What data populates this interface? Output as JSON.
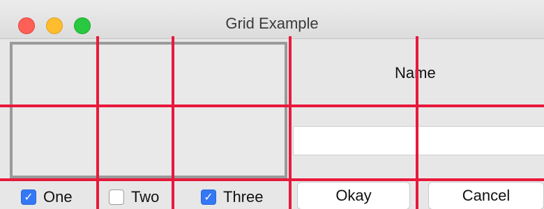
{
  "window": {
    "title": "Grid Example"
  },
  "form": {
    "name_label": "Name",
    "name_value": ""
  },
  "checkboxes": [
    {
      "label": "One",
      "checked": true
    },
    {
      "label": "Two",
      "checked": false
    },
    {
      "label": "Three",
      "checked": true
    }
  ],
  "buttons": {
    "okay": "Okay",
    "cancel": "Cancel"
  },
  "colors": {
    "grid_lines": "#e8193c",
    "checkbox_checked": "#3478f6",
    "close": "#fe5f57",
    "minimize": "#febc2e",
    "maximize": "#28c840"
  }
}
